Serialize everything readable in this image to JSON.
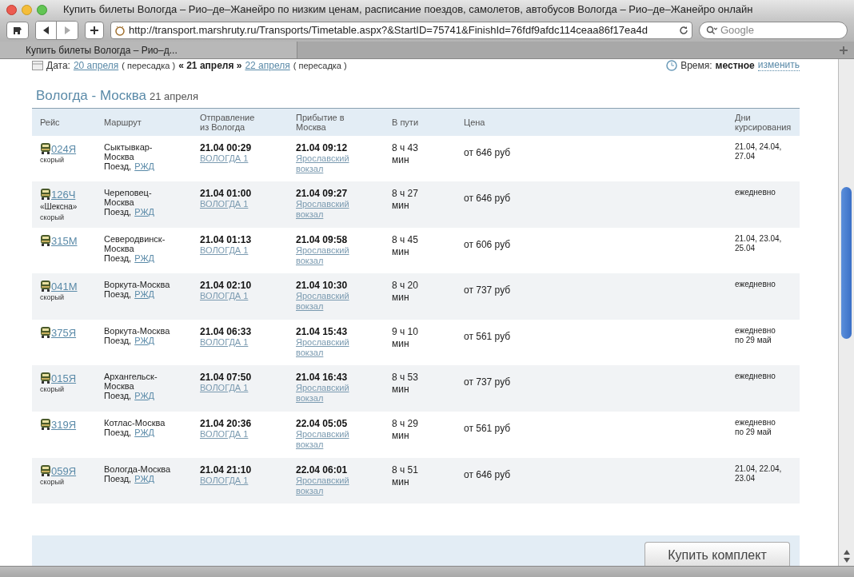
{
  "window": {
    "title": "Купить билеты Вологда – Рио–де–Жанейро по низким ценам, расписание поездов, самолетов, автобусов Вологда – Рио–де–Жанейро онлайн"
  },
  "toolbar": {
    "url": "http://transport.marshruty.ru/Transports/Timetable.aspx?&StartID=75741&FinishId=76fdf9afdc114ceaa86f17ea4d",
    "search_placeholder": "Google"
  },
  "tabs": [
    {
      "label": "Купить билеты Вологда – Рио–д...",
      "selected": true
    }
  ],
  "date_bar": {
    "label": "Дата:",
    "prev": "20 апреля",
    "prev_note": "( пересадка )",
    "current": "« 21 апреля »",
    "next": "22 апреля",
    "next_note": "( пересадка )",
    "time_label": "Время:",
    "time_value": "местное",
    "time_link": "изменить"
  },
  "section": {
    "route": "Вологда - Москва",
    "date": "21 апреля"
  },
  "table": {
    "columns": [
      "Рейс",
      "Маршрут",
      "Отправление из Вологда",
      "Прибытие в Москва",
      "В пути",
      "Цена",
      "Дни курсирования"
    ],
    "rows": [
      {
        "number": "024Я",
        "category": "скорый",
        "route": "Сыктывкар-Москва",
        "carrier_prefix": "Поезд,",
        "carrier": "РЖД",
        "departure": "21.04 00:29",
        "departure_station": "ВОЛОГДА 1",
        "arrival": "21.04 09:12",
        "arrival_station": "Ярославский вокзал",
        "duration": "8 ч 43 мин",
        "price": "от 646 руб",
        "days": "21.04, 24.04, 27.04"
      },
      {
        "number": "126Ч",
        "name": "«Шексна»",
        "category": "скорый",
        "route": "Череповец-Москва",
        "carrier_prefix": "Поезд,",
        "carrier": "РЖД",
        "departure": "21.04 01:00",
        "departure_station": "ВОЛОГДА 1",
        "arrival": "21.04 09:27",
        "arrival_station": "Ярославский вокзал",
        "duration": "8 ч 27 мин",
        "price": "от 646 руб",
        "days": "ежедневно"
      },
      {
        "number": "315М",
        "route": "Северодвинск-Москва",
        "carrier_prefix": "Поезд,",
        "carrier": "РЖД",
        "departure": "21.04 01:13",
        "departure_station": "ВОЛОГДА 1",
        "arrival": "21.04 09:58",
        "arrival_station": "Ярославский вокзал",
        "duration": "8 ч 45 мин",
        "price": "от 606 руб",
        "days": "21.04, 23.04, 25.04"
      },
      {
        "number": "041М",
        "category": "скорый",
        "route": "Воркута-Москва",
        "carrier_prefix": "Поезд,",
        "carrier": "РЖД",
        "departure": "21.04 02:10",
        "departure_station": "ВОЛОГДА 1",
        "arrival": "21.04 10:30",
        "arrival_station": "Ярославский вокзал",
        "duration": "8 ч 20 мин",
        "price": "от 737 руб",
        "days": "ежедневно"
      },
      {
        "number": "375Я",
        "route": "Воркута-Москва",
        "carrier_prefix": "Поезд,",
        "carrier": "РЖД",
        "departure": "21.04 06:33",
        "departure_station": "ВОЛОГДА 1",
        "arrival": "21.04 15:43",
        "arrival_station": "Ярославский вокзал",
        "duration": "9 ч 10 мин",
        "price": "от 561 руб",
        "days": "ежедневно по 29 май"
      },
      {
        "number": "015Я",
        "category": "скорый",
        "route": "Архангельск-Москва",
        "carrier_prefix": "Поезд,",
        "carrier": "РЖД",
        "departure": "21.04 07:50",
        "departure_station": "ВОЛОГДА 1",
        "arrival": "21.04 16:43",
        "arrival_station": "Ярославский вокзал",
        "duration": "8 ч 53 мин",
        "price": "от 737 руб",
        "days": "ежедневно"
      },
      {
        "number": "319Я",
        "route": "Котлас-Москва",
        "carrier_prefix": "Поезд,",
        "carrier": "РЖД",
        "departure": "21.04 20:36",
        "departure_station": "ВОЛОГДА 1",
        "arrival": "22.04 05:05",
        "arrival_station": "Ярославский вокзал",
        "duration": "8 ч 29 мин",
        "price": "от 561 руб",
        "days": "ежедневно по 29 май"
      },
      {
        "number": "059Я",
        "category": "скорый",
        "route": "Вологда-Москва",
        "carrier_prefix": "Поезд,",
        "carrier": "РЖД",
        "departure": "21.04 21:10",
        "departure_station": "ВОЛОГДА 1",
        "arrival": "22.04 06:01",
        "arrival_station": "Ярославский вокзал",
        "duration": "8 ч 51 мин",
        "price": "от 646 руб",
        "days": "21.04, 22.04, 23.04"
      }
    ]
  },
  "footer": {
    "button": "Купить комплект"
  }
}
